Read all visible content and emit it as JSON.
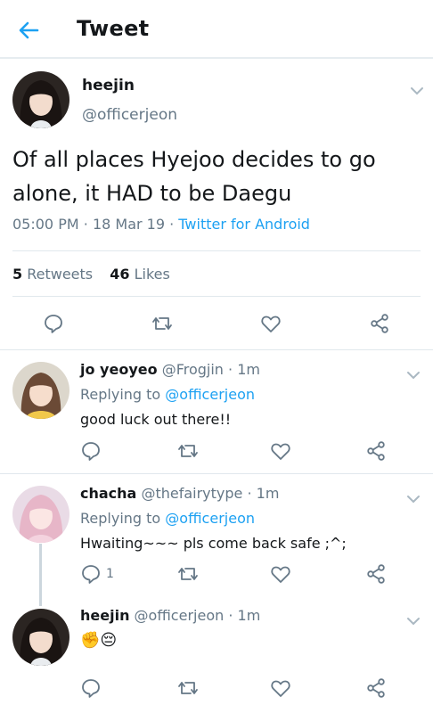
{
  "header": {
    "title": "Tweet",
    "back_icon": "arrow-left-icon",
    "accent": "#1da1f2"
  },
  "tweet": {
    "name": "heejin",
    "handle": "@officerjeon",
    "text": "Of all places Hyejoo decides to go alone, it HAD to be Daegu",
    "time": "05:00 PM",
    "date": "18 Mar 19",
    "source": "Twitter for Android",
    "retweets_count": "5",
    "retweets_label": "Retweets",
    "likes_count": "46",
    "likes_label": "Likes"
  },
  "replies": [
    {
      "name": "jo yeoyeo",
      "handle": "@Frogjin",
      "time": "1m",
      "replying_label": "Replying to",
      "replying_to": "@officerjeon",
      "text": "good luck out there!!",
      "reply_count": ""
    },
    {
      "name": "chacha",
      "handle": "@thefairytype",
      "time": "1m",
      "replying_label": "Replying to",
      "replying_to": "@officerjeon",
      "text": "Hwaiting~~~ pls come back safe ;^;",
      "reply_count": "1"
    },
    {
      "name": "heejin",
      "handle": "@officerjeon",
      "time": "1m",
      "text": "✊😔",
      "reply_count": ""
    }
  ],
  "separator": "·"
}
